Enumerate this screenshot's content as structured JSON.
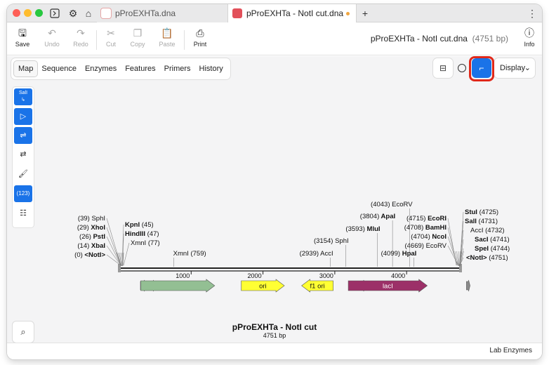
{
  "tabs": [
    {
      "label": "pProEXHTa.dna",
      "active": false
    },
    {
      "label": "pProEXHTa - NotI cut.dna",
      "active": true,
      "modified": true
    }
  ],
  "toolbar": {
    "save": "Save",
    "undo": "Undo",
    "redo": "Redo",
    "cut": "Cut",
    "copy": "Copy",
    "paste": "Paste",
    "print": "Print",
    "info": "Info"
  },
  "document": {
    "title": "pProEXHTa - NotI cut.dna",
    "length": "(4751 bp)"
  },
  "view_tabs": [
    "Map",
    "Sequence",
    "Enzymes",
    "Features",
    "Primers",
    "History"
  ],
  "display_label": "Display",
  "left_panel": {
    "sali_label": "SalI",
    "numbers_label": "(123)"
  },
  "map": {
    "title": "pProEXHTa - NotI cut",
    "subtitle": "4751 bp",
    "total_bp": 4751,
    "ruler_ticks": [
      "1000",
      "2000",
      "3000",
      "4000"
    ],
    "features": [
      {
        "name": "",
        "start": 200,
        "end": 1230,
        "color": "#93bf93",
        "direction": "forward"
      },
      {
        "name": "ori",
        "start": 1600,
        "end": 2200,
        "color": "#ffff33",
        "direction": "forward"
      },
      {
        "name": "f1 ori",
        "start": 2440,
        "end": 2880,
        "color": "#ffff33",
        "direction": "reverse"
      },
      {
        "name": "lacI",
        "start": 3090,
        "end": 4190,
        "color": "#9c3068",
        "direction": "forward"
      }
    ],
    "small_features": [
      {
        "start": 0,
        "end": 90,
        "color": "#8a8a8a",
        "direction": "forward"
      },
      {
        "start": 150,
        "end": 200,
        "color": "#8a8a8a",
        "direction": "forward"
      },
      {
        "start": 3060,
        "end": 3140,
        "color": "#8a8a8a",
        "direction": "forward"
      },
      {
        "start": 4540,
        "end": 4590,
        "color": "#8a8a8a",
        "direction": "forward"
      }
    ],
    "left_cluster_labels": [
      {
        "pos": "(39)",
        "name": "SphI",
        "bold": false
      },
      {
        "pos": "(29)",
        "name": "XhoI",
        "bold": true
      },
      {
        "pos": "(26)",
        "name": "PstI",
        "bold": true
      },
      {
        "pos": "(14)",
        "name": "XbaI",
        "bold": true
      },
      {
        "pos": "(0)",
        "name": "<NotI>",
        "bold": true
      }
    ],
    "left_cluster_labels_b": [
      {
        "name": "KpnI",
        "pos": "(45)",
        "bold": true
      },
      {
        "name": "HindIII",
        "pos": "(47)",
        "bold": true
      },
      {
        "name": "XmnI",
        "pos": "(77)",
        "bold": false
      }
    ],
    "right_cluster_labels_a": [
      {
        "pos": "(4715)",
        "name": "EcoRI",
        "bold": true
      },
      {
        "pos": "(4708)",
        "name": "BamHI",
        "bold": true
      },
      {
        "pos": "(4704)",
        "name": "NcoI",
        "bold": true
      },
      {
        "pos": "(4669)",
        "name": "EcoRV",
        "bold": false
      }
    ],
    "right_cluster_labels_b": [
      {
        "name": "StuI",
        "pos": "(4725)",
        "bold": true
      },
      {
        "name": "SalI",
        "pos": "(4731)",
        "bold": true
      },
      {
        "name": "AccI",
        "pos": "(4732)",
        "bold": false
      },
      {
        "name": "SacI",
        "pos": "(4741)",
        "bold": true
      },
      {
        "name": "SpeI",
        "pos": "(4744)",
        "bold": true
      },
      {
        "name": "<NotI>",
        "pos": "(4751)",
        "bold": true
      }
    ],
    "site_labels": [
      {
        "text_pos": "",
        "name": "XmnI",
        "pos_after": "(759)",
        "bp": 759,
        "bold": false
      },
      {
        "text_pos": "(2939)",
        "name": "AccI",
        "pos_after": "",
        "bp": 2939,
        "bold": false
      },
      {
        "text_pos": "(3154)",
        "name": "SphI",
        "pos_after": "",
        "bp": 3154,
        "bold": false
      },
      {
        "text_pos": "(3593)",
        "name": "MluI",
        "pos_after": "",
        "bp": 3593,
        "bold": true
      },
      {
        "text_pos": "(3804)",
        "name": "ApaI",
        "pos_after": "",
        "bp": 3804,
        "bold": true
      },
      {
        "text_pos": "(4043)",
        "name": "EcoRV",
        "pos_after": "",
        "bp": 4043,
        "bold": false
      },
      {
        "text_pos": "(4099)",
        "name": "HpaI",
        "pos_after": "",
        "bp": 4099,
        "bold": true
      }
    ]
  },
  "status": "Lab Enzymes"
}
